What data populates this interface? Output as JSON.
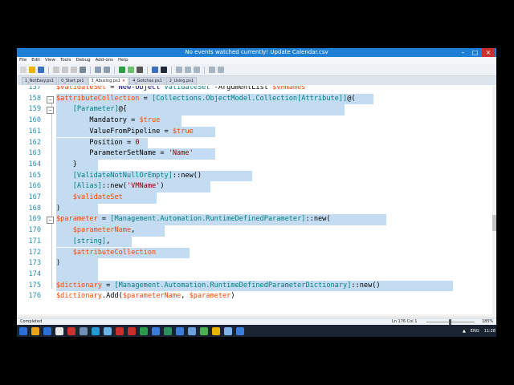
{
  "window": {
    "title": "No events watched currently! Update Calendar.csv"
  },
  "menu": [
    "File",
    "Edit",
    "View",
    "Tools",
    "Debug",
    "Add-ons",
    "Help"
  ],
  "tabs": [
    {
      "label": "1_NotEasy.ps1",
      "active": false
    },
    {
      "label": "0_Start.ps1",
      "active": false
    },
    {
      "label": "3_Abusing.ps1",
      "active": true
    },
    {
      "label": "4_Gotchas.ps1",
      "active": false
    },
    {
      "label": "2_Using.ps1",
      "active": false
    }
  ],
  "editor": {
    "selection_color": "#c4dcf2",
    "lines": [
      {
        "num": "157",
        "fold": "",
        "tokens": [
          [
            "var",
            "$validateSet"
          ],
          [
            "plain",
            " = "
          ],
          [
            "kw",
            "New-Object"
          ],
          [
            "plain",
            " "
          ],
          [
            "typ",
            "ValidateSet"
          ],
          [
            "plain",
            " -ArgumentList "
          ],
          [
            "var",
            "$VMNames"
          ]
        ]
      },
      {
        "num": "158",
        "fold": "−",
        "tokens": [
          [
            "var",
            "$attributeCollection"
          ],
          [
            "plain",
            " = "
          ],
          [
            "typ",
            "[Collections.ObjectModel.Collection[Attribute]]"
          ],
          [
            "plain",
            "@("
          ]
        ]
      },
      {
        "num": "159",
        "fold": "−",
        "tokens": [
          [
            "plain",
            "    "
          ],
          [
            "typ",
            "[Parameter]"
          ],
          [
            "plain",
            "@{"
          ]
        ]
      },
      {
        "num": "160",
        "fold": "",
        "tokens": [
          [
            "plain",
            "        Mandatory = "
          ],
          [
            "var",
            "$true"
          ]
        ]
      },
      {
        "num": "161",
        "fold": "",
        "tokens": [
          [
            "plain",
            "        ValueFromPipeline = "
          ],
          [
            "var",
            "$true"
          ]
        ]
      },
      {
        "num": "162",
        "fold": "",
        "tokens": [
          [
            "plain",
            "        Position = "
          ],
          [
            "str",
            "0"
          ]
        ]
      },
      {
        "num": "163",
        "fold": "",
        "tokens": [
          [
            "plain",
            "        ParameterSetName = "
          ],
          [
            "str",
            "'Name'"
          ]
        ]
      },
      {
        "num": "164",
        "fold": "",
        "tokens": [
          [
            "plain",
            "    }"
          ]
        ]
      },
      {
        "num": "165",
        "fold": "",
        "tokens": [
          [
            "plain",
            "    "
          ],
          [
            "typ",
            "[ValidateNotNullOrEmpty]"
          ],
          [
            "plain",
            "::new()"
          ]
        ]
      },
      {
        "num": "166",
        "fold": "",
        "tokens": [
          [
            "plain",
            "    "
          ],
          [
            "typ",
            "[Alias]"
          ],
          [
            "plain",
            "::new("
          ],
          [
            "str",
            "'VMName'"
          ],
          [
            "plain",
            ")"
          ]
        ]
      },
      {
        "num": "167",
        "fold": "",
        "tokens": [
          [
            "plain",
            "    "
          ],
          [
            "var",
            "$validateSet"
          ]
        ]
      },
      {
        "num": "168",
        "fold": "",
        "tokens": [
          [
            "plain",
            ")"
          ]
        ]
      },
      {
        "num": "169",
        "fold": "−",
        "tokens": [
          [
            "var",
            "$parameter"
          ],
          [
            "plain",
            " = "
          ],
          [
            "typ",
            "[Management.Automation.RuntimeDefinedParameter]"
          ],
          [
            "plain",
            "::new("
          ]
        ]
      },
      {
        "num": "170",
        "fold": "",
        "tokens": [
          [
            "plain",
            "    "
          ],
          [
            "var",
            "$parameterName"
          ],
          [
            "plain",
            ","
          ]
        ]
      },
      {
        "num": "171",
        "fold": "",
        "tokens": [
          [
            "plain",
            "    "
          ],
          [
            "typ",
            "[string]"
          ],
          [
            "plain",
            ","
          ]
        ]
      },
      {
        "num": "172",
        "fold": "",
        "tokens": [
          [
            "plain",
            "    "
          ],
          [
            "var",
            "$attributeCollection"
          ]
        ]
      },
      {
        "num": "173",
        "fold": "",
        "tokens": [
          [
            "plain",
            ")"
          ]
        ]
      },
      {
        "num": "174",
        "fold": "",
        "tokens": [
          [
            "plain",
            ""
          ]
        ]
      },
      {
        "num": "175",
        "fold": "",
        "tokens": [
          [
            "var",
            "$dictionary"
          ],
          [
            "plain",
            " = "
          ],
          [
            "typ",
            "[Management.Automation.RuntimeDefinedParameterDictionary]"
          ],
          [
            "plain",
            "::new()"
          ]
        ]
      },
      {
        "num": "176",
        "fold": "",
        "tokens": [
          [
            "var",
            "$dictionary"
          ],
          [
            "plain",
            "."
          ],
          [
            "plain",
            "Add("
          ],
          [
            "var",
            "$parameterName"
          ],
          [
            "plain",
            ", "
          ],
          [
            "var",
            "$parameter"
          ],
          [
            "plain",
            ")"
          ]
        ]
      }
    ],
    "sel_ranges": [
      [
        0,
        0
      ],
      [
        0,
        76
      ],
      [
        0,
        69
      ],
      [
        0,
        30
      ],
      [
        0,
        38
      ],
      [
        0,
        22
      ],
      [
        0,
        38
      ],
      [
        0,
        10
      ],
      [
        0,
        47
      ],
      [
        0,
        37
      ],
      [
        0,
        24
      ],
      [
        0,
        10
      ],
      [
        0,
        79
      ],
      [
        0,
        26
      ],
      [
        0,
        18
      ],
      [
        0,
        32
      ],
      [
        0,
        10
      ],
      [
        0,
        10
      ],
      [
        0,
        95
      ],
      [
        0,
        0
      ]
    ]
  },
  "status": {
    "left": "Completed",
    "position": "Ln 176  Col 1",
    "zoom": "185%"
  },
  "taskbar": {
    "icon_colors": [
      "#2b6fd6",
      "#e8a317",
      "#2b6fd6",
      "#e8e8e8",
      "#d03030",
      "#6e8fb3",
      "#1f9bd6",
      "#6bb3e8",
      "#c9302c",
      "#c9302c",
      "#2a9d4b",
      "#3b7dd8",
      "#2f8f5f",
      "#3b7dd8",
      "#6aa0d8",
      "#4caf50",
      "#e8b400",
      "#7cb3e8",
      "#3b7dd8"
    ],
    "lang": "ENG",
    "time": "11:28"
  }
}
